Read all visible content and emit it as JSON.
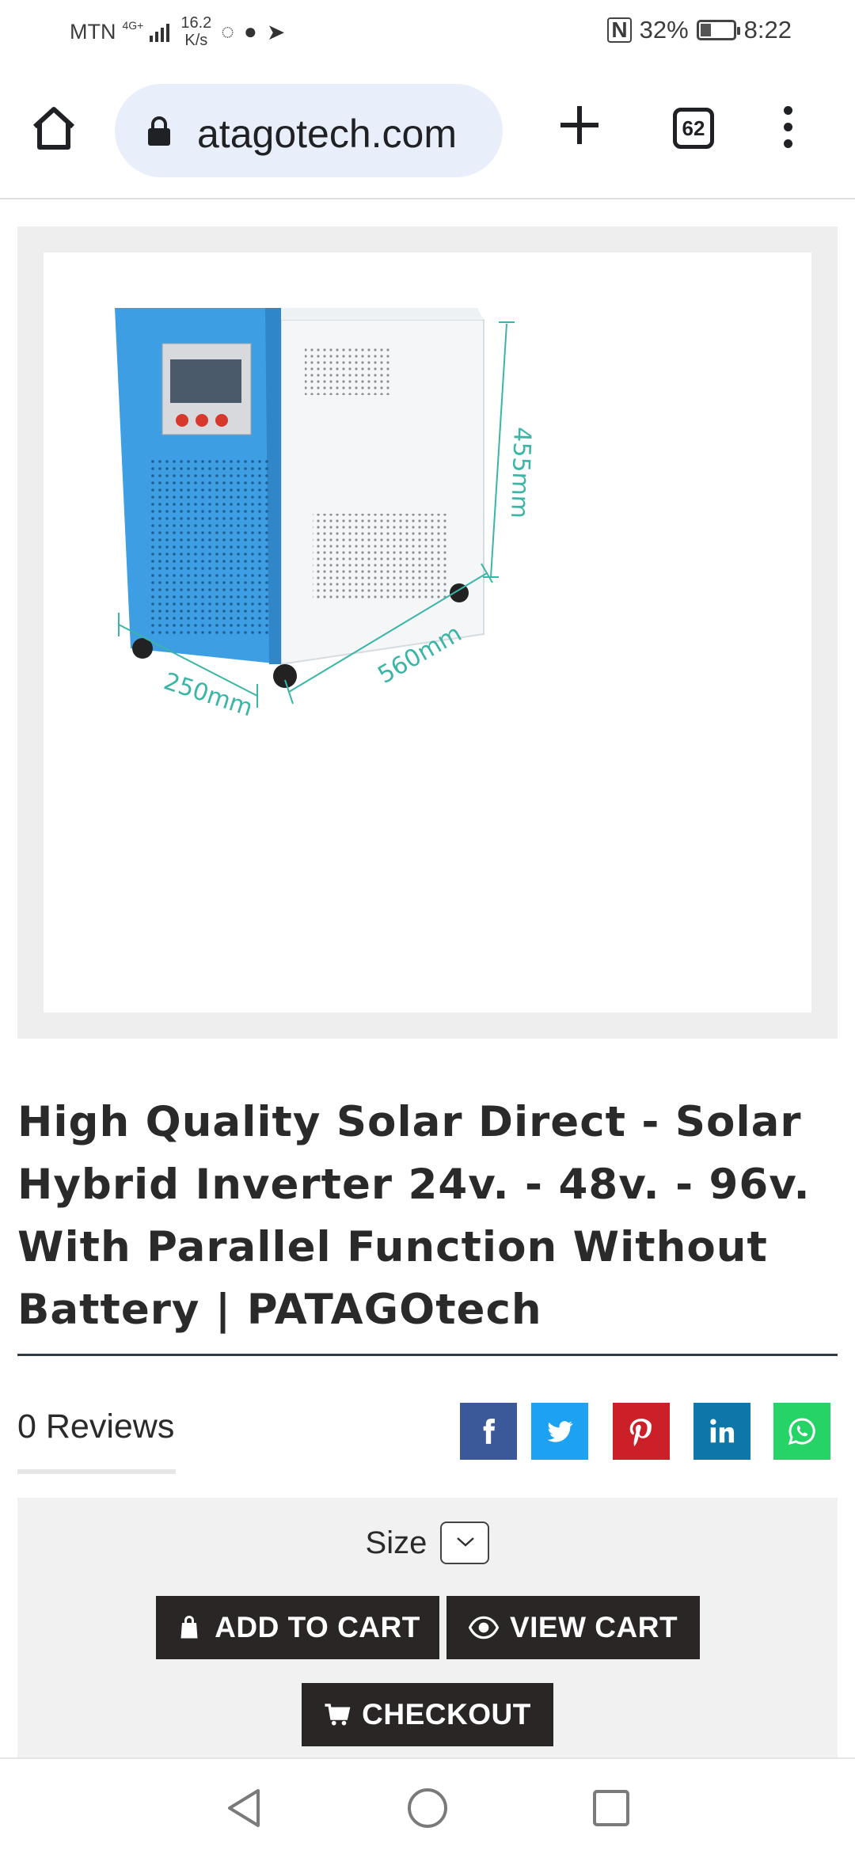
{
  "status_bar": {
    "carrier": "MTN",
    "network": "4G+",
    "speed_value": "16.2",
    "speed_unit": "K/s",
    "battery_percent": "32%",
    "battery_level": 0.32,
    "time": "8:22"
  },
  "browser": {
    "url": "atagotech.com",
    "tab_count": "62"
  },
  "product": {
    "image_labels": [
      "250mm",
      "560mm",
      "455mm"
    ],
    "title": "High Quality Solar Direct - Solar Hybrid Inverter 24v. - 48v. - 96v. With Parallel Function Without Battery | PATAGOtech",
    "reviews": "0 Reviews"
  },
  "share": [
    {
      "name": "facebook",
      "icon": "facebook-icon",
      "color": "#3b5998"
    },
    {
      "name": "twitter",
      "icon": "twitter-icon",
      "color": "#1da1f2"
    },
    {
      "name": "pinterest",
      "icon": "pinterest-icon",
      "color": "#cb2027"
    },
    {
      "name": "linkedin",
      "icon": "linkedin-icon",
      "color": "#0e76a8"
    },
    {
      "name": "whatsapp",
      "icon": "whatsapp-icon",
      "color": "#25d366"
    }
  ],
  "cart": {
    "size_label": "Size",
    "add_to_cart": "ADD TO CART",
    "view_cart": "VIEW CART",
    "checkout": "CHECKOUT"
  }
}
